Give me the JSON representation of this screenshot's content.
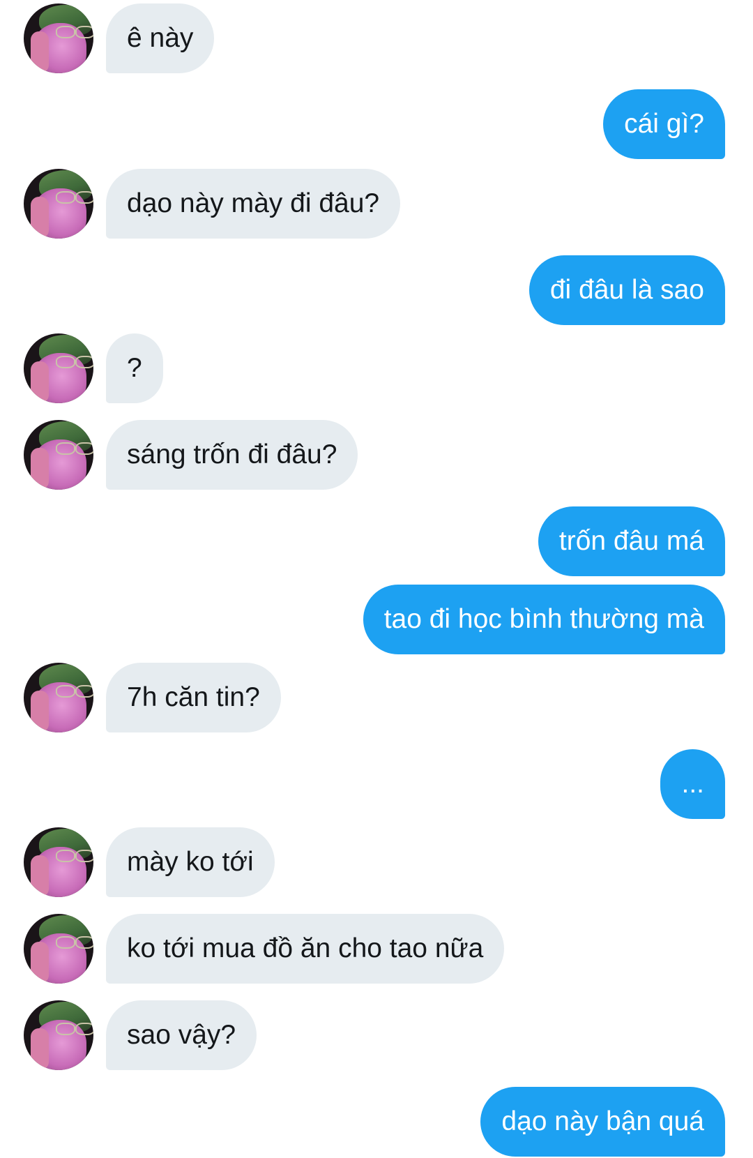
{
  "colors": {
    "incoming_bubble": "#e6ecf0",
    "outgoing_bubble": "#1da1f2",
    "incoming_text": "#14171a",
    "outgoing_text": "#ffffff"
  },
  "messages": [
    {
      "from": "them",
      "text": "ê này"
    },
    {
      "from": "me",
      "text": "cái gì?"
    },
    {
      "from": "them",
      "text": "dạo này mày đi đâu?"
    },
    {
      "from": "me",
      "text": "đi đâu là sao"
    },
    {
      "from": "them",
      "text": "?"
    },
    {
      "from": "them",
      "text": "sáng trốn đi đâu?"
    },
    {
      "from": "me",
      "text": "trốn đâu má"
    },
    {
      "from": "me",
      "text": "tao đi học bình thường mà"
    },
    {
      "from": "them",
      "text": "7h căn tin?"
    },
    {
      "from": "me",
      "text": "..."
    },
    {
      "from": "them",
      "text": "mày ko tới"
    },
    {
      "from": "them",
      "text": "ko tới mua đồ ăn cho tao nữa"
    },
    {
      "from": "them",
      "text": "sao vậy?"
    },
    {
      "from": "me",
      "text": "dạo này bận quá"
    }
  ]
}
